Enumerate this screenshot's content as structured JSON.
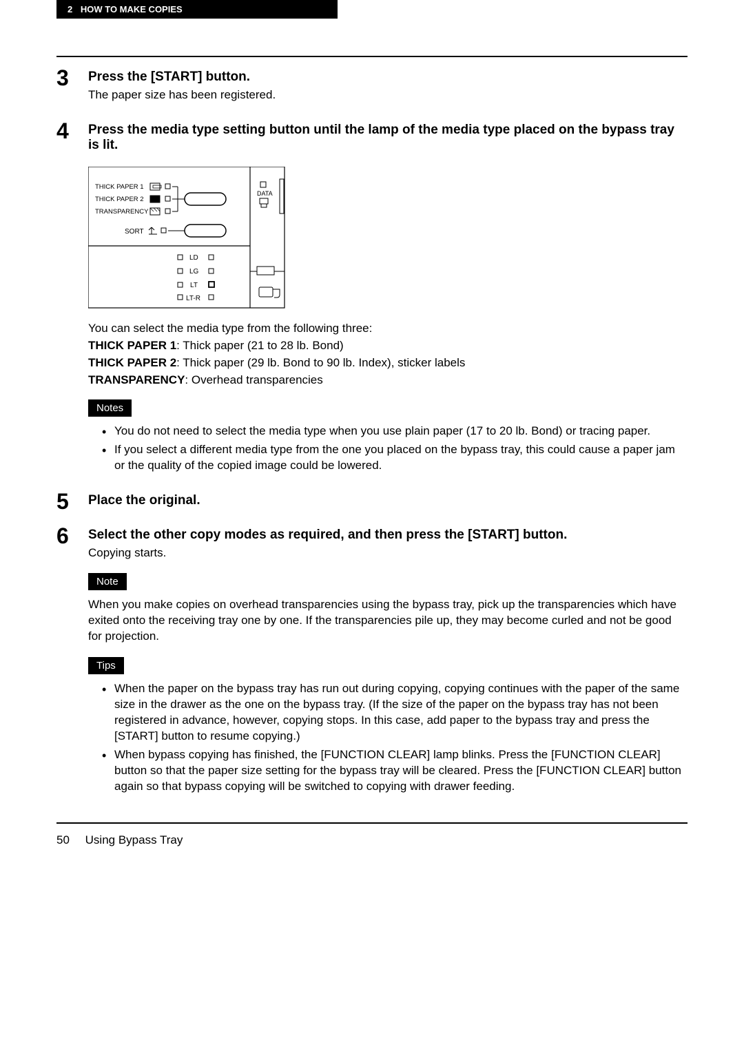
{
  "header": {
    "chapter_num": "2",
    "chapter_title": "HOW TO MAKE COPIES"
  },
  "steps": {
    "s3": {
      "num": "3",
      "title": "Press the [START] button.",
      "body": "The paper size has been registered."
    },
    "s4": {
      "num": "4",
      "title": "Press the media type setting button until the lamp of the media type placed on the bypass tray is lit.",
      "intro": "You can select the media type from the following three:",
      "def1_label": "THICK PAPER 1",
      "def1_text": ": Thick paper (21 to 28 lb. Bond)",
      "def2_label": "THICK PAPER 2",
      "def2_text": ": Thick paper (29 lb. Bond to 90 lb. Index), sticker labels",
      "def3_label": "TRANSPARENCY",
      "def3_text": ": Overhead transparencies",
      "notes_label": "Notes",
      "note1": "You do not need to select the media type when you use plain paper (17 to 20 lb. Bond) or tracing paper.",
      "note2": "If you select a different media type from the one you placed on the bypass tray, this could cause a paper jam or the quality of the copied image could be lowered."
    },
    "s5": {
      "num": "5",
      "title": "Place the original."
    },
    "s6": {
      "num": "6",
      "title": "Select the other copy modes as required, and then press the [START] button.",
      "body": "Copying starts.",
      "note_label": "Note",
      "note_text": "When you make copies on overhead transparencies using the bypass tray, pick up the transparencies which have exited onto the receiving tray one by one. If the transparencies pile up, they may become curled and not be good for projection.",
      "tips_label": "Tips",
      "tip1": "When the paper on the bypass tray has run out during copying, copying continues with the paper of the same size in the drawer as the one on the bypass tray. (If the size of the paper on the bypass tray has not been registered in advance, however, copying stops. In this case, add paper to the bypass tray and press the [START] button to resume copying.)",
      "tip2": "When bypass copying has finished, the [FUNCTION CLEAR] lamp blinks. Press the [FUNCTION CLEAR] button so that the paper size setting for the bypass tray will be cleared. Press the [FUNCTION CLEAR] button again so that bypass copying will be switched to copying with drawer feeding."
    }
  },
  "diagram": {
    "tp1": "THICK PAPER 1",
    "tp2": "THICK PAPER 2",
    "trans": "TRANSPARENCY",
    "sort": "SORT",
    "data": "DATA",
    "ld": "LD",
    "lg": "LG",
    "lt": "LT",
    "ltr": "LT-R"
  },
  "footer": {
    "pagenum": "50",
    "section": "Using Bypass Tray"
  }
}
